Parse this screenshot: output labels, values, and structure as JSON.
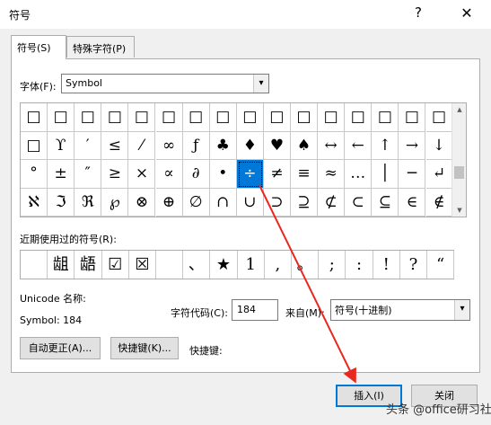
{
  "window": {
    "title": "符号",
    "help_glyph": "?",
    "close_glyph": "✕"
  },
  "tabs": [
    {
      "label": "符号(S)",
      "active": true
    },
    {
      "label": "特殊字符(P)",
      "active": false
    }
  ],
  "font": {
    "label": "字体(F):",
    "value": "Symbol"
  },
  "symbol_grid": {
    "rows": [
      [
        "□",
        "□",
        "□",
        "□",
        "□",
        "□",
        "□",
        "□",
        "□",
        "□",
        "□",
        "□",
        "□",
        "□",
        "□",
        "□"
      ],
      [
        "□",
        "ϒ",
        "′",
        "≤",
        "⁄",
        "∞",
        "ƒ",
        "♣",
        "♦",
        "♥",
        "♠",
        "↔",
        "←",
        "↑",
        "→",
        "↓"
      ],
      [
        "°",
        "±",
        "″",
        "≥",
        "×",
        "∝",
        "∂",
        "•",
        "÷",
        "≠",
        "≡",
        "≈",
        "…",
        "│",
        "─",
        "↵"
      ],
      [
        "ℵ",
        "ℑ",
        "ℜ",
        "℘",
        "⊗",
        "⊕",
        "∅",
        "∩",
        "∪",
        "⊃",
        "⊇",
        "⊄",
        "⊂",
        "⊆",
        "∈",
        "∉"
      ]
    ],
    "selected": {
      "row": 2,
      "col": 8
    }
  },
  "recent": {
    "label": "近期使用过的符号(R):",
    "symbols": [
      "",
      "龃",
      "龉",
      "☑",
      "☒",
      "",
      "、",
      "★",
      "1",
      ",",
      "。",
      ";",
      ":",
      "!",
      "?",
      "“"
    ]
  },
  "unicode_name_label": "Unicode 名称:",
  "symbol_info": "Symbol: 184",
  "char_code": {
    "label": "字符代码(C):",
    "value": "184"
  },
  "from": {
    "label": "来自(M):",
    "value": "符号(十进制)"
  },
  "buttons": {
    "autocorrect": "自动更正(A)...",
    "shortcut_key": "快捷键(K)...",
    "shortcut_label": "快捷键:",
    "insert": "插入(I)",
    "close": "关闭"
  },
  "watermark": "头条 @office研习社",
  "colors": {
    "selection": "#0078d7",
    "annotation_arrow": "#e8281e"
  }
}
